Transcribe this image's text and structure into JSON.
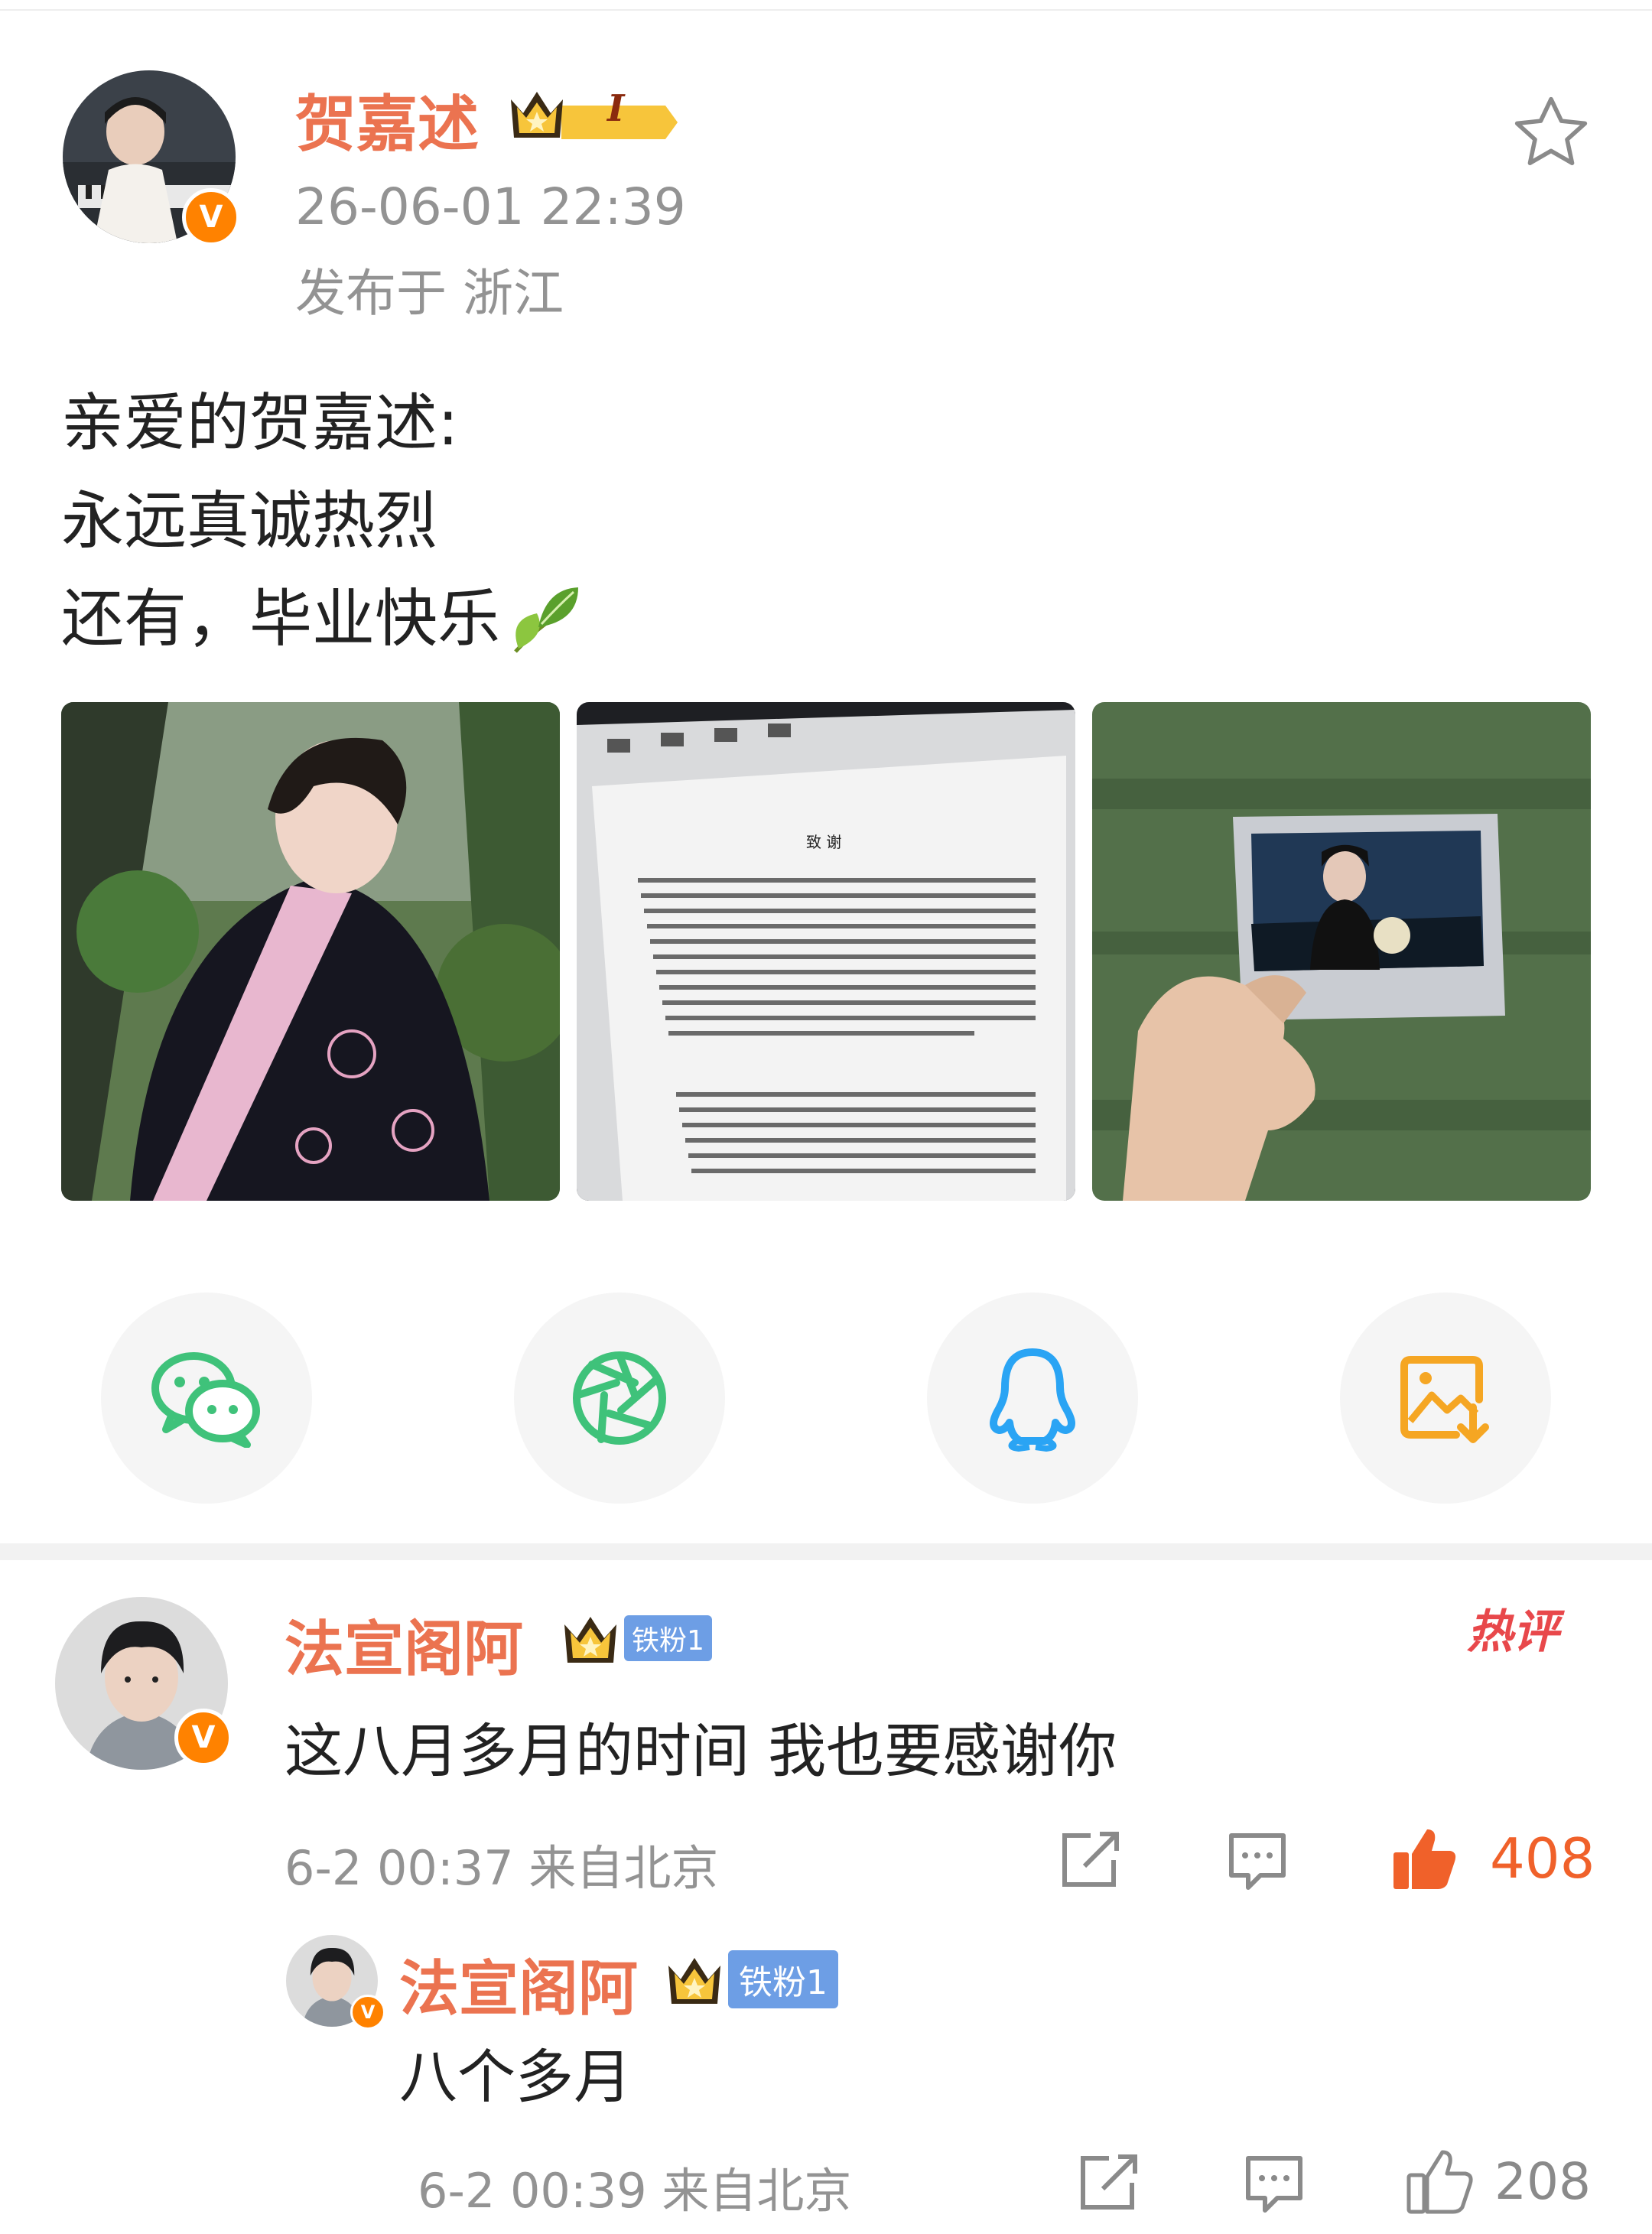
{
  "post": {
    "author": "贺嘉述",
    "badge_level": "I",
    "time": "26-06-01 22:39",
    "location": "发布于 浙江",
    "text_lines": [
      "亲爱的贺嘉述:",
      "永远真诚热烈",
      "还有，毕业快乐"
    ],
    "emoji_icon": "leaf-icon",
    "photos": [
      "photo-graduation-portrait",
      "photo-thesis-acknowledgement-page",
      "photo-polaroid-in-hand"
    ]
  },
  "share": {
    "buttons": [
      {
        "icon": "wechat-icon",
        "color": "#3fc27a"
      },
      {
        "icon": "moments-icon",
        "color": "#3fc27a"
      },
      {
        "icon": "qq-icon",
        "color": "#2aa4f4"
      },
      {
        "icon": "save-image-icon",
        "color": "#f5a623"
      }
    ]
  },
  "comment": {
    "author": "法宣阁阿",
    "fan_badge": "铁粉1",
    "hot_tag": "热评",
    "text": "这八月多月的时间 我也要感谢你",
    "meta": "6-2 00:37 来自北京",
    "likes": "408",
    "like_color": "#f0612a"
  },
  "reply": {
    "author": "法宣阁阿",
    "fan_badge": "铁粉1",
    "text": "八个多月",
    "meta": "6-2 00:39 来自北京",
    "likes": "208"
  },
  "colors": {
    "username": "#eb7350",
    "verified": "#ff8200",
    "meta_gray": "#939393",
    "hot": "#e8484b"
  }
}
